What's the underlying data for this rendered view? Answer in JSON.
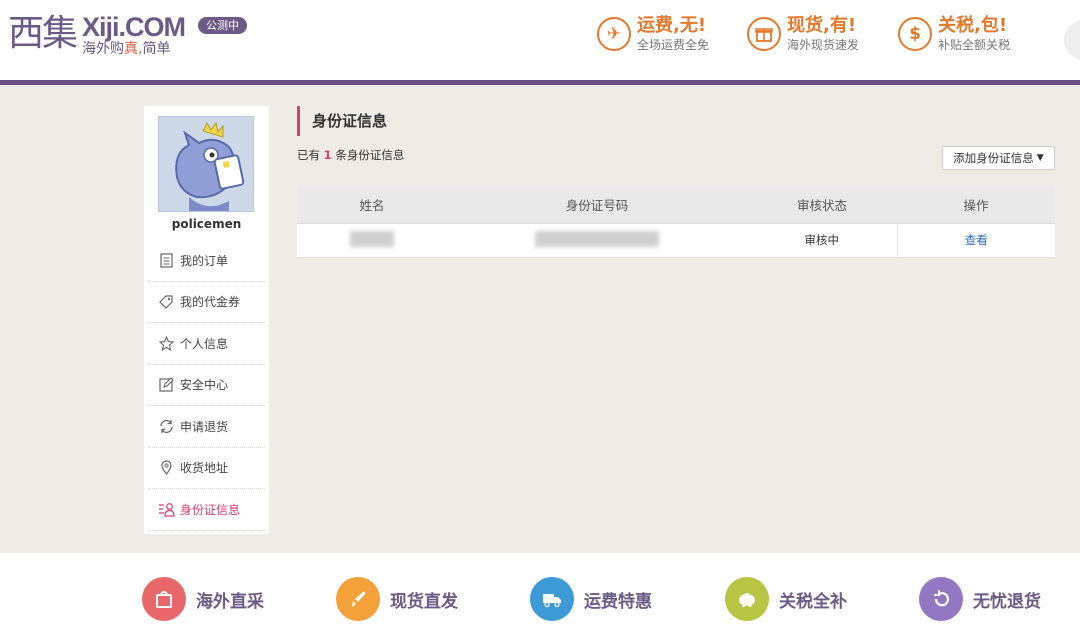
{
  "header": {
    "logo_cn": "西集",
    "logo_en": "Xiji.COM",
    "slogan_pre": "海外购",
    "slogan_mid": "真,",
    "slogan_post": "简单",
    "beta_badge": "公测中",
    "promos": [
      {
        "title": "运费,无!",
        "sub": "全场运费全免",
        "icon": "plane-icon",
        "glyph": "✈"
      },
      {
        "title": "现货,有!",
        "sub": "海外现货速发",
        "icon": "gift-icon",
        "glyph": "田"
      },
      {
        "title": "关税,包!",
        "sub": "补贴全额关税",
        "icon": "dollar-icon",
        "glyph": "$"
      }
    ]
  },
  "sidebar": {
    "username": "policemen",
    "items": [
      {
        "label": "我的订单",
        "icon": "order-list-icon",
        "active": false
      },
      {
        "label": "我的代金券",
        "icon": "voucher-tag-icon",
        "active": false
      },
      {
        "label": "个人信息",
        "icon": "star-icon",
        "active": false
      },
      {
        "label": "安全中心",
        "icon": "edit-icon",
        "active": false
      },
      {
        "label": "申请退货",
        "icon": "refresh-icon",
        "active": false
      },
      {
        "label": "收货地址",
        "icon": "location-pin-icon",
        "active": false
      },
      {
        "label": "身份证信息",
        "icon": "id-card-icon",
        "active": true
      }
    ]
  },
  "main": {
    "title": "身份证信息",
    "count_pre": "已有",
    "count": "1",
    "count_post": "条身份证信息",
    "add_button": "添加身份证信息",
    "table": {
      "headers": [
        "姓名",
        "身份证号码",
        "审核状态",
        "操作"
      ],
      "rows": [
        {
          "status": "审核中",
          "action": "查看"
        }
      ]
    }
  },
  "footer": {
    "features": [
      {
        "label": "海外直采",
        "icon": "bag-icon",
        "color": "#e8676b"
      },
      {
        "label": "现货直发",
        "icon": "rocket-icon",
        "color": "#f5a13a"
      },
      {
        "label": "运费特惠",
        "icon": "truck-icon",
        "color": "#3d9ad6"
      },
      {
        "label": "关税全补",
        "icon": "piggy-bank-icon",
        "color": "#b8c444"
      },
      {
        "label": "无忧退货",
        "icon": "return-icon",
        "color": "#9477c2"
      }
    ]
  },
  "colors": {
    "brand_purple": "#6c5a86",
    "accent_pink": "#d93e6f",
    "promo_orange": "#e5792b",
    "link_blue": "#2c6dc4"
  }
}
